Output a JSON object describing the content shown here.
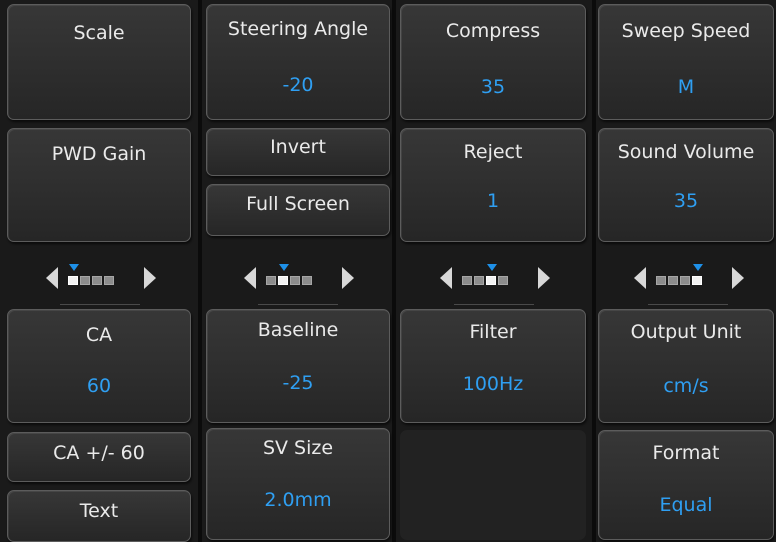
{
  "columns": [
    {
      "top_button": {
        "label": "Scale",
        "value": ""
      },
      "mid_buttons": [
        {
          "label": "PWD Gain",
          "value": ""
        }
      ],
      "pager": {
        "page": 1,
        "total": 4
      },
      "bottom_buttons": [
        {
          "label": "CA",
          "value": "60"
        },
        {
          "label": "CA +/- 60"
        },
        {
          "label": "Text"
        }
      ]
    },
    {
      "top_button": {
        "label": "Steering Angle",
        "value": "-20"
      },
      "mid_buttons": [
        {
          "label": "Invert"
        },
        {
          "label": "Full Screen"
        }
      ],
      "pager": {
        "page": 2,
        "total": 4
      },
      "bottom_buttons": [
        {
          "label": "Baseline",
          "value": "-25"
        },
        {
          "label": "SV Size",
          "value": "2.0mm"
        }
      ]
    },
    {
      "top_button": {
        "label": "Compress",
        "value": "35"
      },
      "mid_buttons": [
        {
          "label": "Reject",
          "value": "1"
        }
      ],
      "pager": {
        "page": 3,
        "total": 4
      },
      "bottom_buttons": [
        {
          "label": "Filter",
          "value": "100Hz"
        }
      ]
    },
    {
      "top_button": {
        "label": "Sweep Speed",
        "value": "M"
      },
      "mid_buttons": [
        {
          "label": "Sound Volume",
          "value": "35"
        }
      ],
      "pager": {
        "page": 4,
        "total": 4
      },
      "bottom_buttons": [
        {
          "label": "Output Unit",
          "value": "cm/s"
        },
        {
          "label": "Format",
          "value": "Equal"
        }
      ]
    }
  ],
  "colors": {
    "label": "#eaeaea",
    "value": "#2f9ff2",
    "marker": "#1e90e8"
  },
  "icons": {
    "page_left": "left-triangle-icon",
    "page_right": "right-triangle-icon"
  }
}
